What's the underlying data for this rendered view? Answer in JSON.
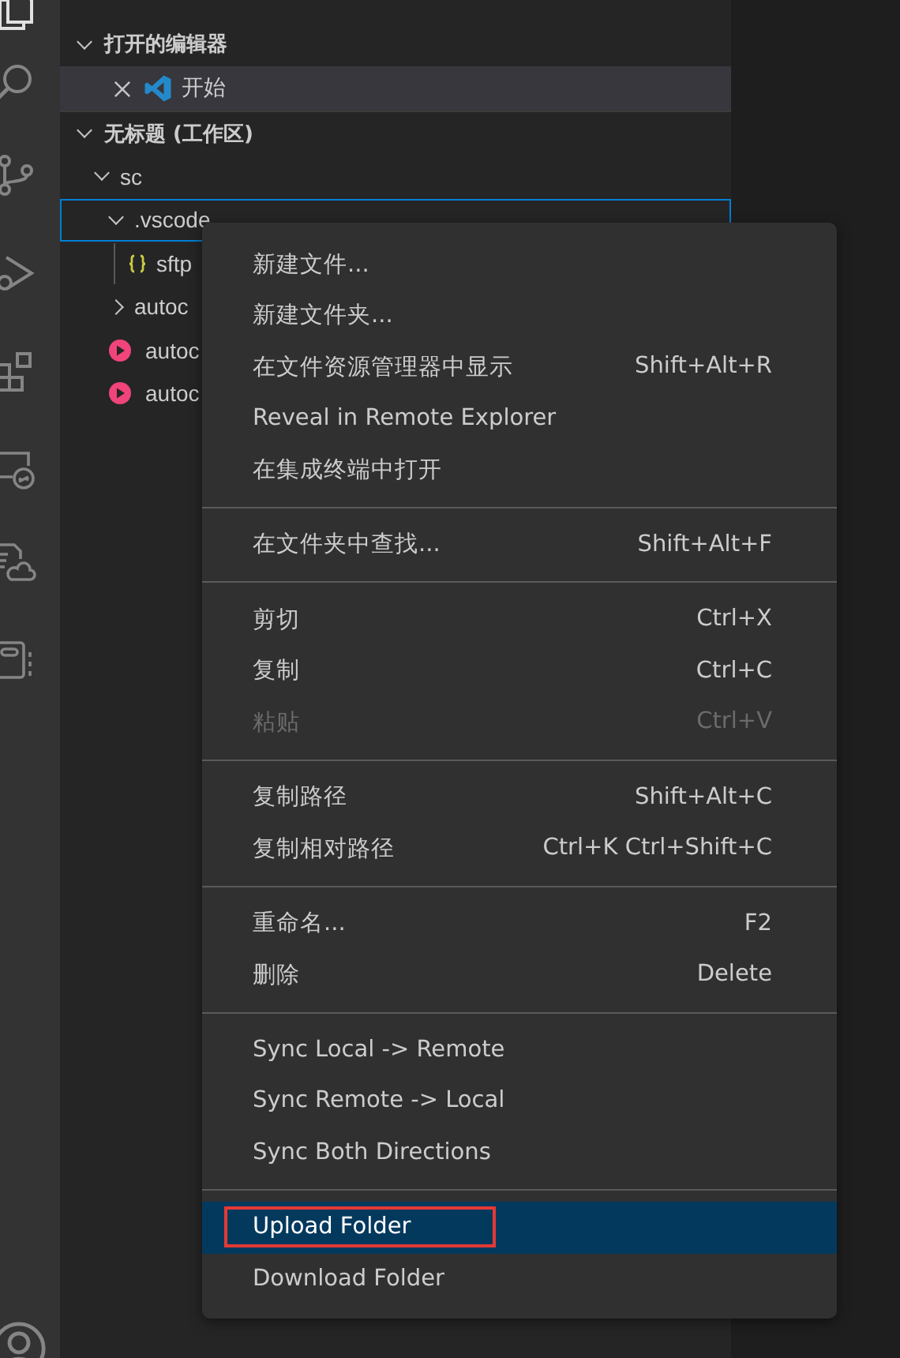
{
  "activity_bar": {
    "items": [
      {
        "kind": "explorer",
        "selected": true
      },
      {
        "kind": "search",
        "selected": false
      },
      {
        "kind": "source-control",
        "selected": false
      },
      {
        "kind": "run",
        "selected": false
      },
      {
        "kind": "extensions",
        "selected": false
      },
      {
        "kind": "remote",
        "selected": false
      },
      {
        "kind": "cloud-file",
        "selected": false
      },
      {
        "kind": "notebook",
        "selected": false
      }
    ]
  },
  "open_editors": {
    "title": "打开的编辑器",
    "expanded": true,
    "items": [
      {
        "label": "开始",
        "selected": true
      }
    ]
  },
  "workspace": {
    "title": "无标题 (工作区)",
    "expanded": true,
    "tree": [
      {
        "label": "sc",
        "kind": "folder",
        "expanded": true,
        "focused": false,
        "children": [
          {
            "label": ".vscode",
            "kind": "folder",
            "expanded": true,
            "focused": true,
            "children": [
              {
                "label": "sftp",
                "kind": "json",
                "focused": false
              }
            ]
          },
          {
            "label": "autoc",
            "kind": "folder",
            "expanded": false,
            "focused": false
          },
          {
            "label": "autoc",
            "kind": "media",
            "focused": false
          },
          {
            "label": "autoc",
            "kind": "media",
            "focused": false
          }
        ]
      }
    ]
  },
  "context_menu": {
    "items": [
      {
        "kind": "item",
        "label": "新建文件...",
        "selected": false,
        "disabled": false
      },
      {
        "kind": "item",
        "label": "新建文件夹...",
        "selected": false,
        "disabled": false
      },
      {
        "kind": "item",
        "label": "在文件资源管理器中显示",
        "shortcut": "Shift+Alt+R",
        "selected": false,
        "disabled": false
      },
      {
        "kind": "item",
        "label": "Reveal in Remote Explorer",
        "selected": false,
        "disabled": false
      },
      {
        "kind": "item",
        "label": "在集成终端中打开",
        "selected": false,
        "disabled": false
      },
      {
        "kind": "separator"
      },
      {
        "kind": "item",
        "label": "在文件夹中查找...",
        "shortcut": "Shift+Alt+F",
        "selected": false,
        "disabled": false
      },
      {
        "kind": "separator"
      },
      {
        "kind": "item",
        "label": "剪切",
        "shortcut": "Ctrl+X",
        "selected": false,
        "disabled": false
      },
      {
        "kind": "item",
        "label": "复制",
        "shortcut": "Ctrl+C",
        "selected": false,
        "disabled": false
      },
      {
        "kind": "item",
        "label": "粘贴",
        "shortcut": "Ctrl+V",
        "selected": false,
        "disabled": true
      },
      {
        "kind": "separator"
      },
      {
        "kind": "item",
        "label": "复制路径",
        "shortcut": "Shift+Alt+C",
        "selected": false,
        "disabled": false
      },
      {
        "kind": "item",
        "label": "复制相对路径",
        "shortcut": "Ctrl+K Ctrl+Shift+C",
        "selected": false,
        "disabled": false
      },
      {
        "kind": "separator"
      },
      {
        "kind": "item",
        "label": "重命名...",
        "shortcut": "F2",
        "selected": false,
        "disabled": false
      },
      {
        "kind": "item",
        "label": "删除",
        "shortcut": "Delete",
        "selected": false,
        "disabled": false
      },
      {
        "kind": "separator"
      },
      {
        "kind": "item",
        "label": "Sync Local -> Remote",
        "selected": false,
        "disabled": false
      },
      {
        "kind": "item",
        "label": "Sync Remote -> Local",
        "selected": false,
        "disabled": false
      },
      {
        "kind": "item",
        "label": "Sync Both Directions",
        "selected": false,
        "disabled": false
      },
      {
        "kind": "separator"
      },
      {
        "kind": "item",
        "label": "Upload Folder",
        "selected": true,
        "disabled": false,
        "highlighted": true
      },
      {
        "kind": "item",
        "label": "Download Folder",
        "selected": false,
        "disabled": false
      }
    ]
  }
}
